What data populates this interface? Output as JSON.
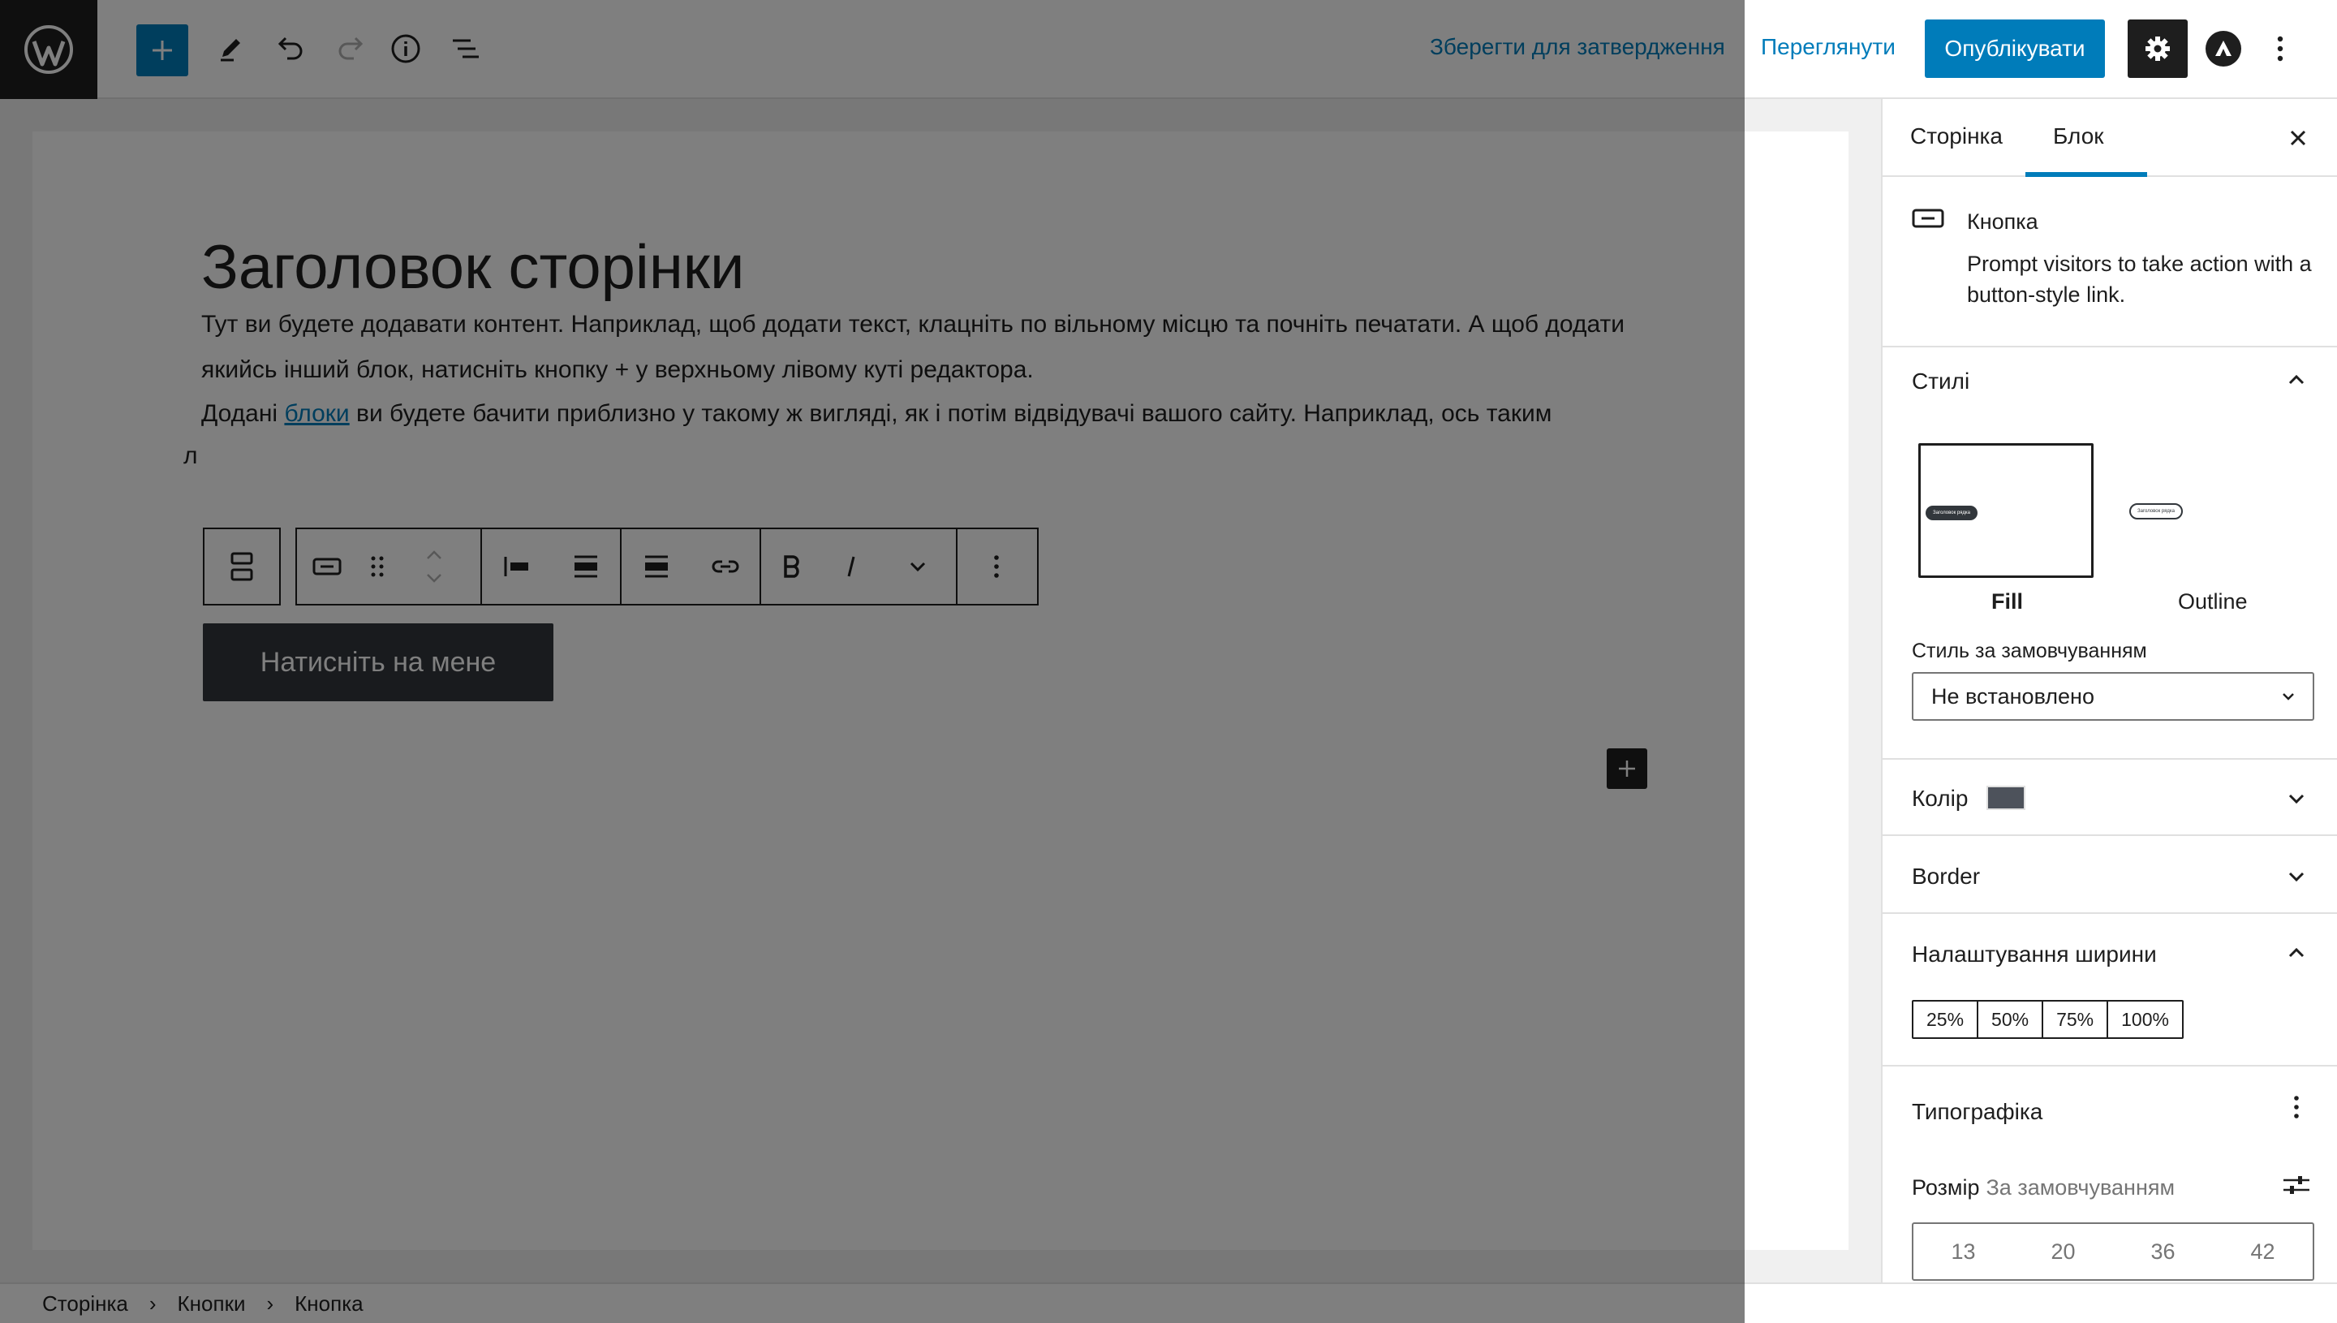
{
  "header": {
    "save_draft": "Зберегти для затвердження",
    "preview": "Переглянути",
    "publish": "Опублікувати"
  },
  "editor": {
    "title": "Заголовок сторінки",
    "paragraph1": "Тут ви будете додавати контент. Наприклад, щоб додати текст, клацніть по вільному місцю та почніть печатати. А щоб додати якийсь інший блок, натисніть кнопку + у верхньому лівому куті редактора.",
    "paragraph2_before": "Додані ",
    "paragraph2_link": "блоки",
    "paragraph2_after": " ви будете бачити приблизно у такому ж вигляді, як і потім відвідувачі вашого сайту. Наприклад, ось таким",
    "paragraph3_partial": "л",
    "button_text": "Натисніть на мене"
  },
  "sidebar": {
    "tabs": [
      "Сторінка",
      "Блок"
    ],
    "block": {
      "name": "Кнопка",
      "description": "Prompt visitors to take action with a button-style link."
    },
    "styles": {
      "title": "Стилі",
      "fill_label": "Fill",
      "outline_label": "Outline",
      "mini_button_text": "Заголовок рядка",
      "default_style_label": "Стиль за замовчуванням",
      "default_style_value": "Не встановлено"
    },
    "color_title": "Колір",
    "border_title": "Border",
    "width": {
      "title": "Налаштування ширини",
      "options": [
        "25%",
        "50%",
        "75%",
        "100%"
      ]
    },
    "typography": {
      "title": "Типографіка",
      "size_label": "Розмір",
      "size_default": "За замовчуванням",
      "sizes": [
        "13",
        "20",
        "36",
        "42"
      ]
    }
  },
  "breadcrumb": [
    "Сторінка",
    "Кнопки",
    "Кнопка"
  ],
  "colors": {
    "accent": "#007cba",
    "button_bg": "#32373c",
    "swatch": "#4d525b"
  }
}
